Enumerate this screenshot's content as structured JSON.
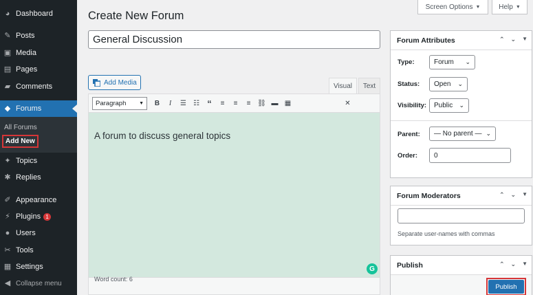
{
  "sidebar": {
    "items": [
      {
        "label": "Dashboard",
        "icon": "dashboard-icon",
        "glyph": "◕"
      },
      {
        "label": "Posts",
        "icon": "pin-icon",
        "glyph": "✎"
      },
      {
        "label": "Media",
        "icon": "media-icon",
        "glyph": "▣"
      },
      {
        "label": "Pages",
        "icon": "pages-icon",
        "glyph": "▤"
      },
      {
        "label": "Comments",
        "icon": "comment-icon",
        "glyph": "▰"
      },
      {
        "label": "Forums",
        "icon": "forums-icon",
        "glyph": "◆"
      },
      {
        "label": "Topics",
        "icon": "topics-icon",
        "glyph": "✦"
      },
      {
        "label": "Replies",
        "icon": "replies-icon",
        "glyph": "✱"
      },
      {
        "label": "Appearance",
        "icon": "appearance-icon",
        "glyph": "✐"
      },
      {
        "label": "Plugins",
        "icon": "plugins-icon",
        "glyph": "⚡",
        "badge": "1"
      },
      {
        "label": "Users",
        "icon": "users-icon",
        "glyph": "●"
      },
      {
        "label": "Tools",
        "icon": "tools-icon",
        "glyph": "✂"
      },
      {
        "label": "Settings",
        "icon": "settings-icon",
        "glyph": "▦"
      }
    ],
    "submenu": {
      "all_forums": "All Forums",
      "add_new": "Add New"
    },
    "collapse": "Collapse menu"
  },
  "top": {
    "screen_options": "Screen Options",
    "help": "Help"
  },
  "page_title": "Create New Forum",
  "title_value": "General Discussion",
  "editor": {
    "add_media": "Add Media",
    "tab_visual": "Visual",
    "tab_text": "Text",
    "format": "Paragraph",
    "content": "A forum to discuss general topics",
    "word_count": "Word count: 6"
  },
  "attributes": {
    "title": "Forum Attributes",
    "type_label": "Type:",
    "type_value": "Forum",
    "status_label": "Status:",
    "status_value": "Open",
    "visibility_label": "Visibility:",
    "visibility_value": "Public",
    "parent_label": "Parent:",
    "parent_value": "— No parent —",
    "order_label": "Order:",
    "order_value": "0"
  },
  "moderators": {
    "title": "Forum Moderators",
    "hint": "Separate user-names with commas"
  },
  "publish": {
    "title": "Publish",
    "button": "Publish"
  },
  "colors": {
    "accent": "#2271b1",
    "sidebar": "#1d2327",
    "editor_bg": "#d3e8de",
    "highlight": "#d63638"
  }
}
